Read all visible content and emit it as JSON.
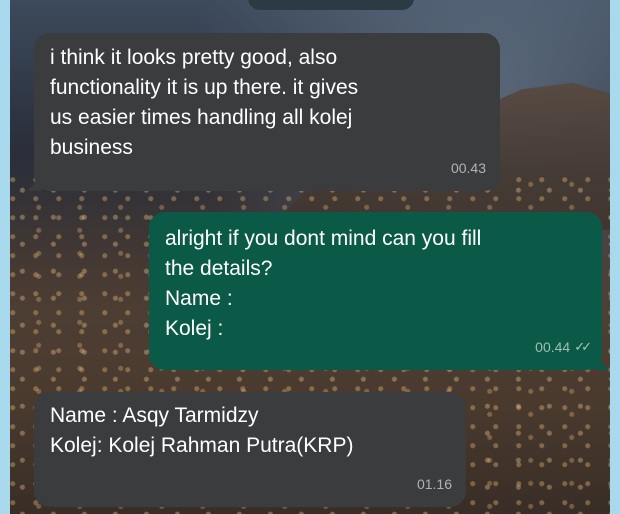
{
  "messages": [
    {
      "direction": "incoming",
      "text": "i think it looks pretty good, also\nfunctionality it is up there. it gives\nus easier times handling all kolej\nbusiness",
      "time": "00.43"
    },
    {
      "direction": "outgoing",
      "text": "alright if you dont mind can you  fill\nthe details?\nName :\nKolej :",
      "time": "00.44",
      "status_icon": "double-check-icon",
      "status_glyph": "✓✓"
    },
    {
      "direction": "incoming",
      "text": "Name : Asqy Tarmidzy\nKolej: Kolej Rahman Putra(KRP)",
      "time": "01.16"
    }
  ],
  "colors": {
    "page_border": "#a9d9ec",
    "incoming_bubble": "#3a3c3e",
    "outgoing_bubble": "#0b5a48",
    "text": "#ffffff"
  }
}
